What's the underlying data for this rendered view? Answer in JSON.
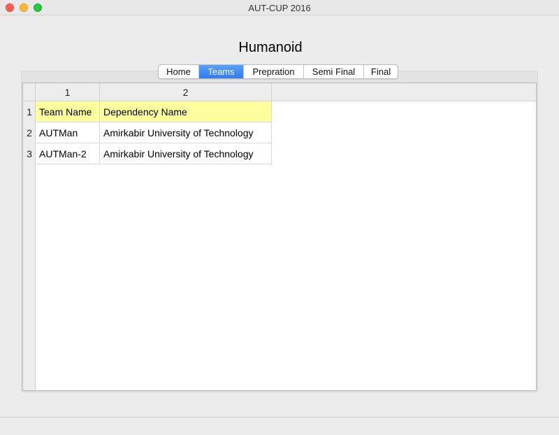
{
  "window": {
    "title": "AUT-CUP 2016"
  },
  "page": {
    "heading": "Humanoid"
  },
  "tabs": [
    {
      "label": "Home",
      "active": false
    },
    {
      "label": "Teams",
      "active": true
    },
    {
      "label": "Prepration",
      "active": false
    },
    {
      "label": "Semi Final",
      "active": false
    },
    {
      "label": "Final",
      "active": false
    }
  ],
  "table": {
    "column_headers": [
      "1",
      "2"
    ],
    "row_headers": [
      "1",
      "2",
      "3"
    ],
    "rows": [
      [
        "Team Name",
        "Dependency Name"
      ],
      [
        "AUTMan",
        "Amirkabir University of Technology"
      ],
      [
        "AUTMan-2",
        "Amirkabir University of Technology"
      ]
    ],
    "highlight_color": "#ffff9e"
  },
  "colors": {
    "tab_active": "#2f7cf6",
    "window_bg": "#ececec"
  }
}
